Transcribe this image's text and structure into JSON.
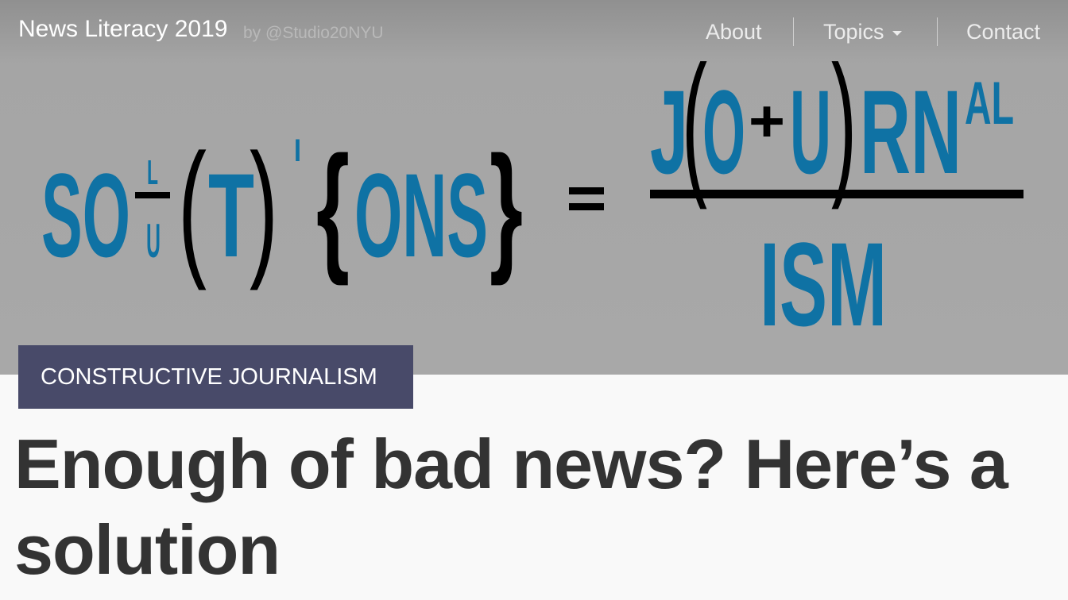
{
  "header": {
    "site_title": "News Literacy 2019",
    "byline": "by @Studio20NYU",
    "nav": [
      {
        "label": "About"
      },
      {
        "label": "Topics"
      },
      {
        "label": "Contact"
      }
    ]
  },
  "hero_art": {
    "left": {
      "so": "SO",
      "frac_top": "L",
      "frac_bottom": "U",
      "open_paren": "(",
      "t": "T",
      "close_paren": ")",
      "i": "I",
      "open_brace": "{",
      "ons": "ONS",
      "close_brace": "}"
    },
    "equals": "=",
    "right": {
      "j": "J",
      "open_paren": "(",
      "o": "O",
      "plus": "+",
      "u": "U",
      "close_paren": ")",
      "rn": "RN",
      "al": "AL",
      "denominator": "ISM"
    },
    "colors": {
      "blue": "#0f72a4",
      "black": "#000000"
    }
  },
  "article": {
    "category": "CONSTRUCTIVE JOURNALISM",
    "headline": "Enough of bad news? Here’s a solution"
  },
  "colors": {
    "category_bg": "#484a69",
    "headline_text": "#333333"
  }
}
